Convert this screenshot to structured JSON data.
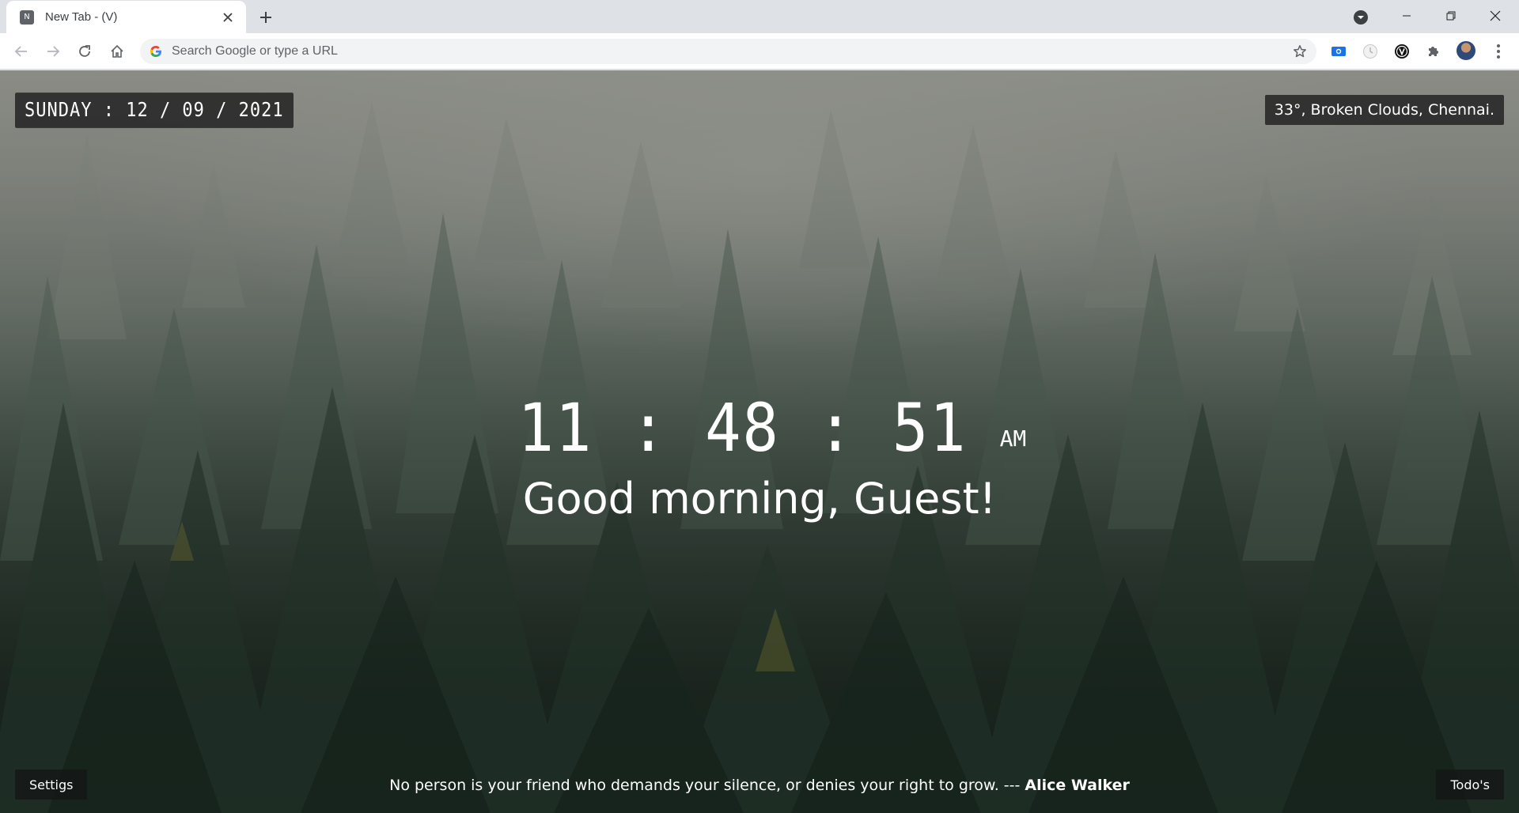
{
  "browser": {
    "tab": {
      "title": "New Tab - (V)",
      "favicon_letter": "N",
      "close_icon": "close-icon"
    },
    "new_tab_icon": "plus-icon",
    "window_controls": [
      "minimize-icon",
      "restore-icon",
      "close-icon"
    ],
    "omnibox": {
      "placeholder": "Search Google or type a URL",
      "value": ""
    },
    "extensions": [
      "screenshot-extension-icon",
      "clock-extension-icon",
      "v-extension-icon",
      "puzzle-icon"
    ]
  },
  "page": {
    "date": "SUNDAY : 12 / 09 / 2021",
    "weather": "33°, Broken Clouds, Chennai.",
    "clock": {
      "time": "11 : 48 : 51",
      "ampm": "AM"
    },
    "greeting": "Good morning, Guest!",
    "quote": {
      "text": "No person is your friend who demands your silence, or denies your right to grow. --- ",
      "author": "Alice Walker"
    },
    "settings_label": "Settigs",
    "todos_label": "Todo's"
  },
  "colors": {
    "tabstrip": "#dee1e6",
    "toolbar": "#ffffff",
    "overlay_box": "#262626",
    "text": "#ffffff"
  }
}
